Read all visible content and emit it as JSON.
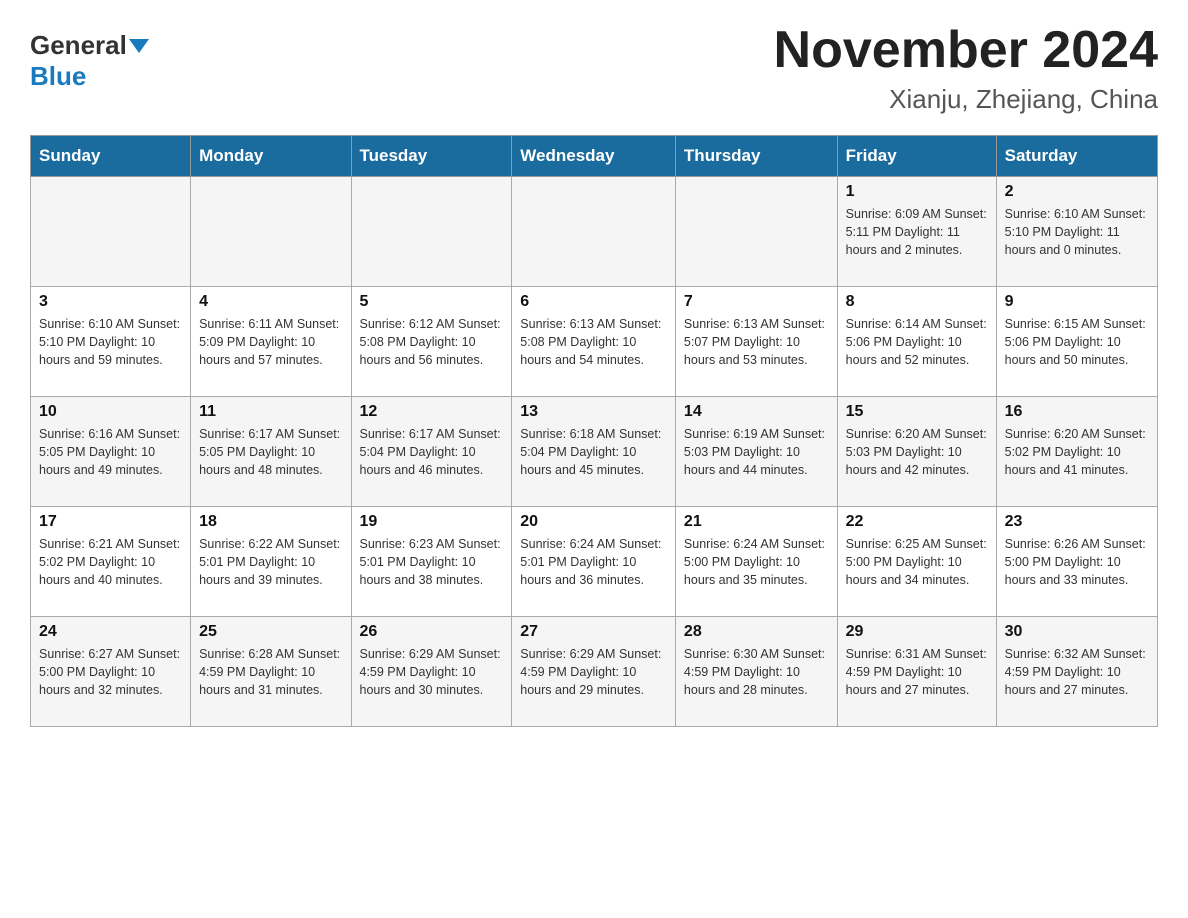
{
  "header": {
    "logo_general": "General",
    "logo_blue": "Blue",
    "month_title": "November 2024",
    "location": "Xianju, Zhejiang, China"
  },
  "weekdays": [
    "Sunday",
    "Monday",
    "Tuesday",
    "Wednesday",
    "Thursday",
    "Friday",
    "Saturday"
  ],
  "weeks": [
    [
      {
        "day": "",
        "info": ""
      },
      {
        "day": "",
        "info": ""
      },
      {
        "day": "",
        "info": ""
      },
      {
        "day": "",
        "info": ""
      },
      {
        "day": "",
        "info": ""
      },
      {
        "day": "1",
        "info": "Sunrise: 6:09 AM\nSunset: 5:11 PM\nDaylight: 11 hours\nand 2 minutes."
      },
      {
        "day": "2",
        "info": "Sunrise: 6:10 AM\nSunset: 5:10 PM\nDaylight: 11 hours\nand 0 minutes."
      }
    ],
    [
      {
        "day": "3",
        "info": "Sunrise: 6:10 AM\nSunset: 5:10 PM\nDaylight: 10 hours\nand 59 minutes."
      },
      {
        "day": "4",
        "info": "Sunrise: 6:11 AM\nSunset: 5:09 PM\nDaylight: 10 hours\nand 57 minutes."
      },
      {
        "day": "5",
        "info": "Sunrise: 6:12 AM\nSunset: 5:08 PM\nDaylight: 10 hours\nand 56 minutes."
      },
      {
        "day": "6",
        "info": "Sunrise: 6:13 AM\nSunset: 5:08 PM\nDaylight: 10 hours\nand 54 minutes."
      },
      {
        "day": "7",
        "info": "Sunrise: 6:13 AM\nSunset: 5:07 PM\nDaylight: 10 hours\nand 53 minutes."
      },
      {
        "day": "8",
        "info": "Sunrise: 6:14 AM\nSunset: 5:06 PM\nDaylight: 10 hours\nand 52 minutes."
      },
      {
        "day": "9",
        "info": "Sunrise: 6:15 AM\nSunset: 5:06 PM\nDaylight: 10 hours\nand 50 minutes."
      }
    ],
    [
      {
        "day": "10",
        "info": "Sunrise: 6:16 AM\nSunset: 5:05 PM\nDaylight: 10 hours\nand 49 minutes."
      },
      {
        "day": "11",
        "info": "Sunrise: 6:17 AM\nSunset: 5:05 PM\nDaylight: 10 hours\nand 48 minutes."
      },
      {
        "day": "12",
        "info": "Sunrise: 6:17 AM\nSunset: 5:04 PM\nDaylight: 10 hours\nand 46 minutes."
      },
      {
        "day": "13",
        "info": "Sunrise: 6:18 AM\nSunset: 5:04 PM\nDaylight: 10 hours\nand 45 minutes."
      },
      {
        "day": "14",
        "info": "Sunrise: 6:19 AM\nSunset: 5:03 PM\nDaylight: 10 hours\nand 44 minutes."
      },
      {
        "day": "15",
        "info": "Sunrise: 6:20 AM\nSunset: 5:03 PM\nDaylight: 10 hours\nand 42 minutes."
      },
      {
        "day": "16",
        "info": "Sunrise: 6:20 AM\nSunset: 5:02 PM\nDaylight: 10 hours\nand 41 minutes."
      }
    ],
    [
      {
        "day": "17",
        "info": "Sunrise: 6:21 AM\nSunset: 5:02 PM\nDaylight: 10 hours\nand 40 minutes."
      },
      {
        "day": "18",
        "info": "Sunrise: 6:22 AM\nSunset: 5:01 PM\nDaylight: 10 hours\nand 39 minutes."
      },
      {
        "day": "19",
        "info": "Sunrise: 6:23 AM\nSunset: 5:01 PM\nDaylight: 10 hours\nand 38 minutes."
      },
      {
        "day": "20",
        "info": "Sunrise: 6:24 AM\nSunset: 5:01 PM\nDaylight: 10 hours\nand 36 minutes."
      },
      {
        "day": "21",
        "info": "Sunrise: 6:24 AM\nSunset: 5:00 PM\nDaylight: 10 hours\nand 35 minutes."
      },
      {
        "day": "22",
        "info": "Sunrise: 6:25 AM\nSunset: 5:00 PM\nDaylight: 10 hours\nand 34 minutes."
      },
      {
        "day": "23",
        "info": "Sunrise: 6:26 AM\nSunset: 5:00 PM\nDaylight: 10 hours\nand 33 minutes."
      }
    ],
    [
      {
        "day": "24",
        "info": "Sunrise: 6:27 AM\nSunset: 5:00 PM\nDaylight: 10 hours\nand 32 minutes."
      },
      {
        "day": "25",
        "info": "Sunrise: 6:28 AM\nSunset: 4:59 PM\nDaylight: 10 hours\nand 31 minutes."
      },
      {
        "day": "26",
        "info": "Sunrise: 6:29 AM\nSunset: 4:59 PM\nDaylight: 10 hours\nand 30 minutes."
      },
      {
        "day": "27",
        "info": "Sunrise: 6:29 AM\nSunset: 4:59 PM\nDaylight: 10 hours\nand 29 minutes."
      },
      {
        "day": "28",
        "info": "Sunrise: 6:30 AM\nSunset: 4:59 PM\nDaylight: 10 hours\nand 28 minutes."
      },
      {
        "day": "29",
        "info": "Sunrise: 6:31 AM\nSunset: 4:59 PM\nDaylight: 10 hours\nand 27 minutes."
      },
      {
        "day": "30",
        "info": "Sunrise: 6:32 AM\nSunset: 4:59 PM\nDaylight: 10 hours\nand 27 minutes."
      }
    ]
  ]
}
